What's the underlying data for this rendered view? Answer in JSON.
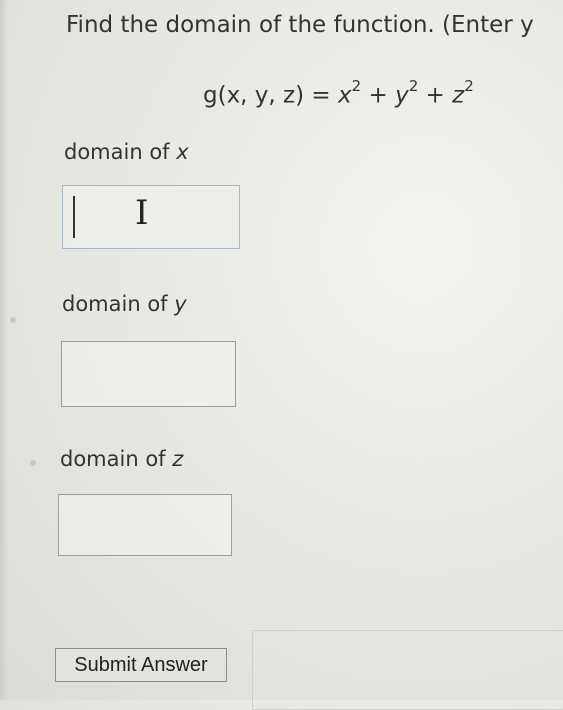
{
  "question": {
    "prompt": "Find the domain of the function. (Enter y"
  },
  "formula": {
    "lhs": "g(x, y, z) = ",
    "t1": "x",
    "t2": "y",
    "t3": "z",
    "exponent": "2",
    "plus": " + "
  },
  "fields": [
    {
      "label_prefix": "domain of ",
      "variable": "x",
      "value": ""
    },
    {
      "label_prefix": "domain of ",
      "variable": "y",
      "value": ""
    },
    {
      "label_prefix": "domain of ",
      "variable": "z",
      "value": ""
    }
  ],
  "submit": {
    "label": "Submit Answer"
  }
}
